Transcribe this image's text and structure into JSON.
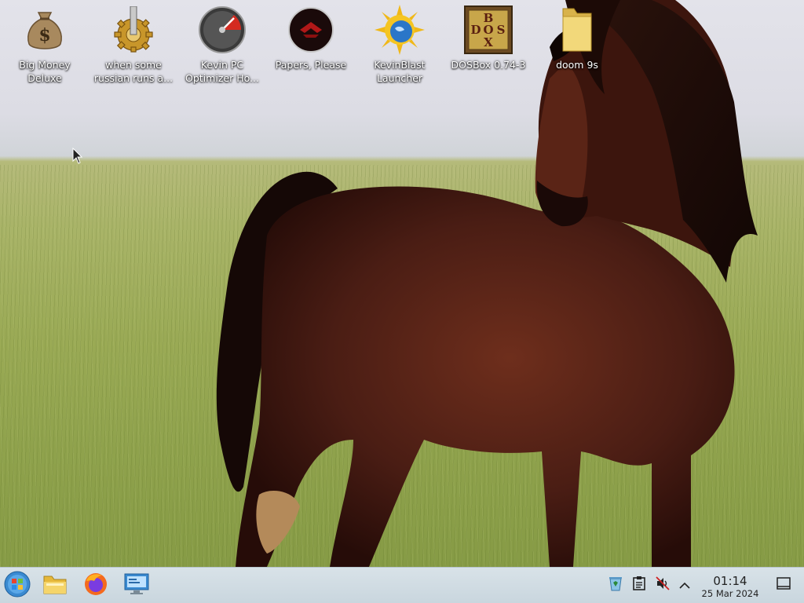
{
  "desktop": {
    "icons": [
      {
        "label": "Big Money Deluxe",
        "icon": "money-bag-icon"
      },
      {
        "label": "when some russian runs a...",
        "icon": "gear-icon"
      },
      {
        "label": "Kevin PC Optimizer Ho...",
        "icon": "speedometer-icon"
      },
      {
        "label": "Papers, Please",
        "icon": "papers-please-emblem-icon"
      },
      {
        "label": "KevinBlast Launcher",
        "icon": "sun-globe-icon"
      },
      {
        "label": "DOSBox 0.74-3",
        "icon": "dosbox-icon"
      },
      {
        "label": "doom 9s",
        "icon": "folder-icon"
      }
    ]
  },
  "taskbar": {
    "start": {
      "icon": "windows-orb-icon"
    },
    "pinned": [
      {
        "icon": "file-explorer-icon"
      },
      {
        "icon": "firefox-icon"
      },
      {
        "icon": "remote-desktop-icon"
      }
    ],
    "tray": [
      {
        "icon": "recycle-bin-icon"
      },
      {
        "icon": "clipboard-icon"
      },
      {
        "icon": "volume-muted-icon"
      },
      {
        "icon": "chevron-up-icon"
      }
    ],
    "clock": {
      "time": "01:14",
      "date": "25 Mar 2024"
    },
    "show_desktop": {
      "icon": "show-desktop-icon"
    }
  }
}
